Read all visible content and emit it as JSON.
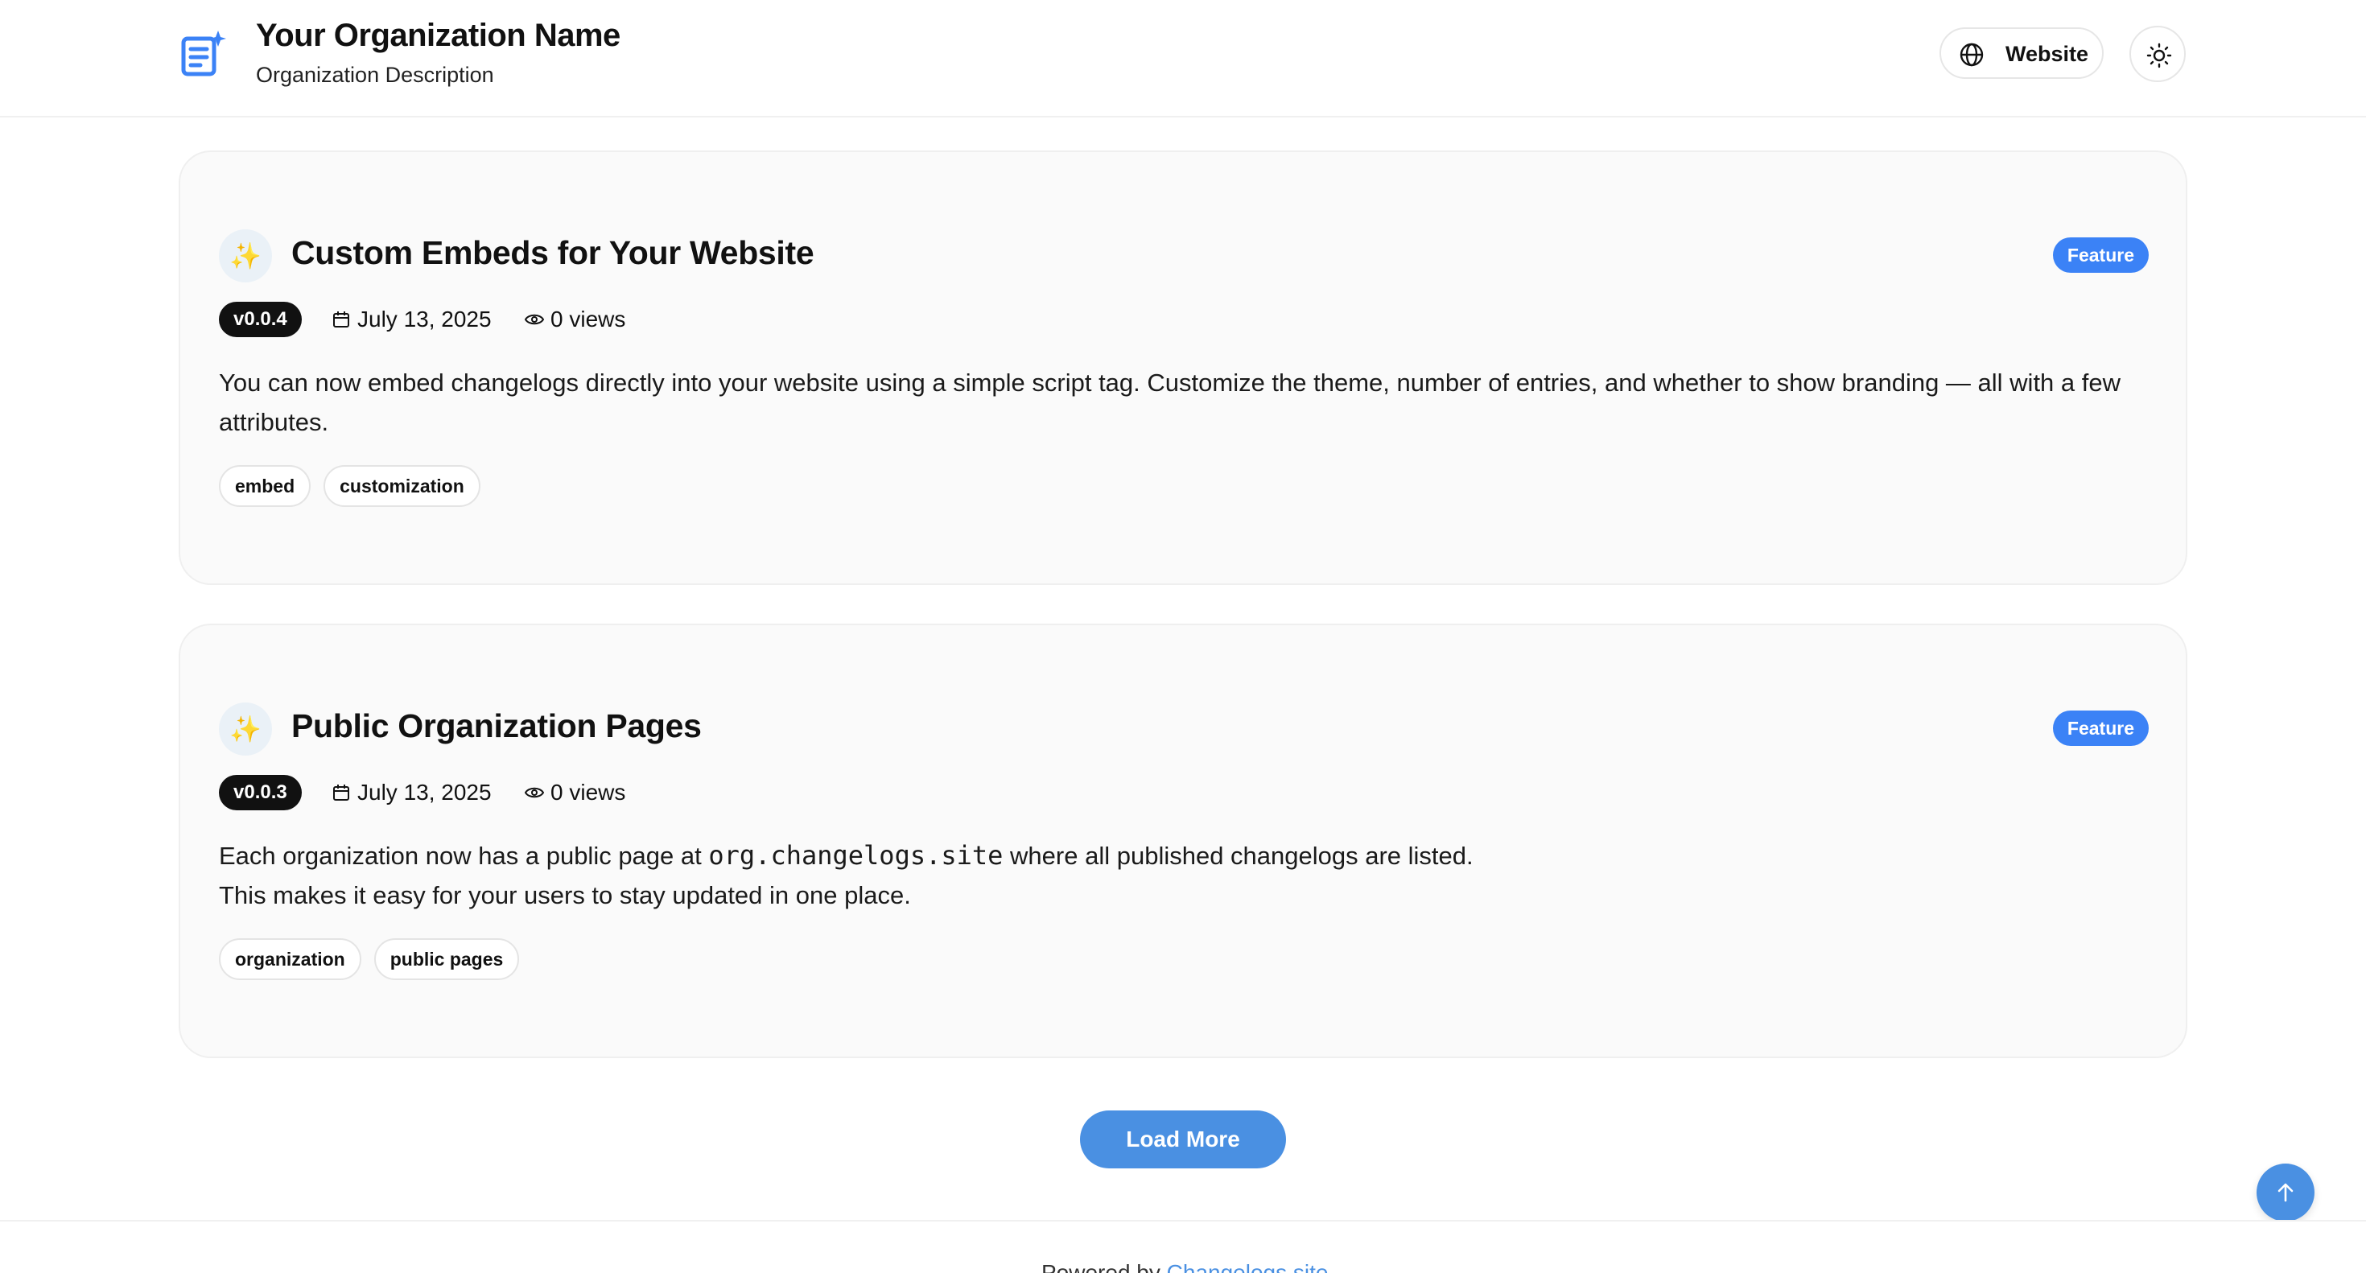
{
  "header": {
    "org_name": "Your Organization Name",
    "org_description": "Organization Description",
    "logo_icon": "document-sparkle-icon",
    "website_label": "Website",
    "theme_icon": "sun-icon"
  },
  "changelogs": [
    {
      "title": "Custom Embeds for Your Website",
      "type": "Feature",
      "version": "v0.0.4",
      "date": "July 13, 2025",
      "views": "0 views",
      "body": "You can now embed changelogs directly into your website using a simple script tag. Customize the theme, number of entries, and whether to show branding — all with a few attributes.",
      "tags": [
        "embed",
        "customization"
      ]
    },
    {
      "title": "Public Organization Pages",
      "type": "Feature",
      "version": "v0.0.3",
      "date": "July 13, 2025",
      "views": "0 views",
      "body_before_code": "Each organization now has a public page at",
      "body_code": "org.changelogs.site",
      "body_after_code": "where all published changelogs are listed.",
      "body_line2": "This makes it easy for your users to stay updated in one place.",
      "tags": [
        "organization",
        "public pages"
      ]
    }
  ],
  "load_more_label": "Load More",
  "footer": {
    "powered_by": "Powered by",
    "link_text": "Changelogs.site"
  },
  "colors": {
    "accent": "#4a90e2",
    "feature_badge": "#3b82f6",
    "version_badge": "#111111"
  }
}
